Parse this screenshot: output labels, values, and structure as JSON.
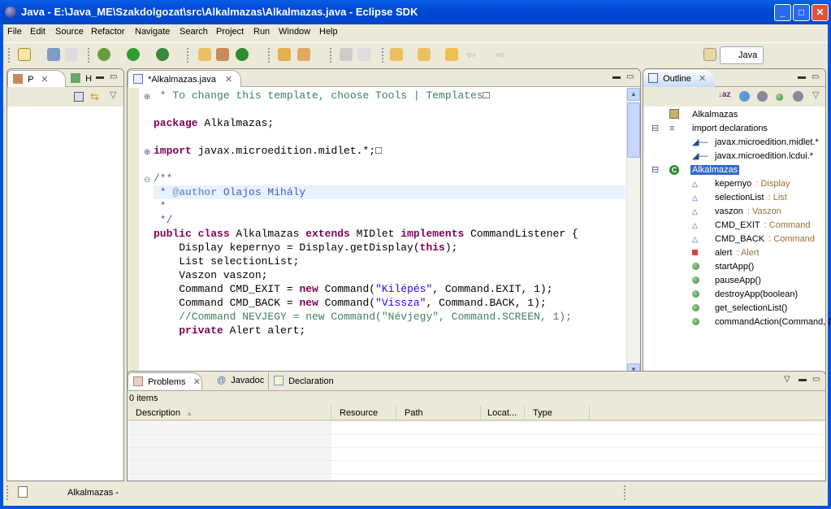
{
  "window": {
    "title": "Java - E:\\Java_ME\\Szakdolgozat\\src\\Alkalmazas\\Alkalmazas.java - Eclipse SDK",
    "min": "_",
    "max": "□",
    "close": "✕"
  },
  "menu": [
    "File",
    "Edit",
    "Source",
    "Refactor",
    "Navigate",
    "Search",
    "Project",
    "Run",
    "Window",
    "Help"
  ],
  "perspective": {
    "label": "Java"
  },
  "left_panel": {
    "tabs": [
      {
        "label": "P",
        "close": "✕"
      },
      {
        "label": "H"
      }
    ]
  },
  "editor": {
    "tab": "*Alkalmazas.java",
    "close": "✕",
    "lines": [
      [
        [
          "c",
          " * To change this template, choose Tools | Templates"
        ],
        [
          "t",
          "□"
        ]
      ],
      [],
      [
        [
          "k",
          "package"
        ],
        [
          "t",
          " Alkalmazas;"
        ]
      ],
      [],
      [
        [
          "k",
          "import"
        ],
        [
          "t",
          " javax.microedition.midlet.*;"
        ],
        [
          "t",
          "□"
        ]
      ],
      [],
      [
        [
          "c",
          "/**"
        ]
      ],
      [
        [
          "j",
          " * "
        ],
        [
          "jt",
          "@author"
        ],
        [
          "j",
          " Olajos Mihály"
        ]
      ],
      [
        [
          "j",
          " *"
        ]
      ],
      [
        [
          "j",
          " */"
        ]
      ],
      [
        [
          "k",
          "public class"
        ],
        [
          "t",
          " Alkalmazas "
        ],
        [
          "k",
          "extends"
        ],
        [
          "t",
          " MIDlet "
        ],
        [
          "k",
          "implements"
        ],
        [
          "t",
          " CommandListener {"
        ]
      ],
      [
        [
          "t",
          "    Display kepernyo = Display.getDisplay("
        ],
        [
          "k",
          "this"
        ],
        [
          "t",
          ");"
        ]
      ],
      [
        [
          "t",
          "    List selectionList;"
        ]
      ],
      [
        [
          "t",
          "    Vaszon vaszon;"
        ]
      ],
      [
        [
          "t",
          "    Command CMD_EXIT = "
        ],
        [
          "k",
          "new"
        ],
        [
          "t",
          " Command("
        ],
        [
          "s",
          "\"Kilépés\""
        ],
        [
          "t",
          ", Command.EXIT, 1);"
        ]
      ],
      [
        [
          "t",
          "    Command CMD_BACK = "
        ],
        [
          "k",
          "new"
        ],
        [
          "t",
          " Command("
        ],
        [
          "s",
          "\"Vissza\""
        ],
        [
          "t",
          ", Command.BACK, 1);"
        ]
      ],
      [
        [
          "c",
          "    //Command NEVJEGY = new Command(\"Névjegy\", Command.SCREEN, 1);"
        ]
      ],
      [
        [
          "t",
          "    "
        ],
        [
          "k",
          "private"
        ],
        [
          "t",
          " Alert alert;"
        ]
      ]
    ]
  },
  "outline": {
    "tab": "Outline",
    "close": "✕",
    "items": [
      {
        "label": "Alkalmazas",
        "type": "",
        "icon": "package-icon",
        "level": 0
      },
      {
        "label": "import declarations",
        "type": "",
        "icon": "imports-icon",
        "level": 0,
        "expander": "⊟"
      },
      {
        "label": "javax.microedition.midlet.*",
        "type": "",
        "icon": "import-icon",
        "level": 1
      },
      {
        "label": "javax.microedition.lcdui.*",
        "type": "",
        "icon": "import-icon",
        "level": 1
      },
      {
        "label": "Alkalmazas",
        "type": "",
        "icon": "class-icon",
        "level": 0,
        "expander": "⊟",
        "selected": true
      },
      {
        "label": "kepernyo",
        "type": " : Display",
        "icon": "field-default-icon",
        "level": 1
      },
      {
        "label": "selectionList",
        "type": " : List",
        "icon": "field-default-icon",
        "level": 1
      },
      {
        "label": "vaszon",
        "type": " : Vaszon",
        "icon": "field-default-icon",
        "level": 1
      },
      {
        "label": "CMD_EXIT",
        "type": " : Command",
        "icon": "field-default-icon",
        "level": 1
      },
      {
        "label": "CMD_BACK",
        "type": " : Command",
        "icon": "field-default-icon",
        "level": 1
      },
      {
        "label": "alert",
        "type": " : Alert",
        "icon": "field-private-icon",
        "level": 1
      },
      {
        "label": "startApp()",
        "type": "",
        "icon": "method-public-icon",
        "level": 1
      },
      {
        "label": "pauseApp()",
        "type": "",
        "icon": "method-public-icon",
        "level": 1
      },
      {
        "label": "destroyApp(boolean)",
        "type": "",
        "icon": "method-public-icon",
        "level": 1
      },
      {
        "label": "get_selectionList()",
        "type": "",
        "icon": "method-public-icon",
        "level": 1
      },
      {
        "label": "commandAction(Command, Di",
        "type": "",
        "icon": "method-public-icon",
        "level": 1
      }
    ]
  },
  "problems": {
    "tabs": [
      {
        "label": "Problems",
        "close": "✕"
      },
      {
        "label": "Javadoc"
      },
      {
        "label": "Declaration"
      }
    ],
    "count": "0 items",
    "columns": [
      "Description",
      "Resource",
      "Path",
      "Locat...",
      "Type"
    ],
    "sort_indicator": "▲"
  },
  "status": {
    "text": "Alkalmazas -"
  },
  "colors": {
    "keyword": "#7f0055",
    "comment": "#3f7f5f",
    "string": "#2a00ff",
    "javadoc": "#3f5fbf",
    "selection": "#316ac5"
  }
}
